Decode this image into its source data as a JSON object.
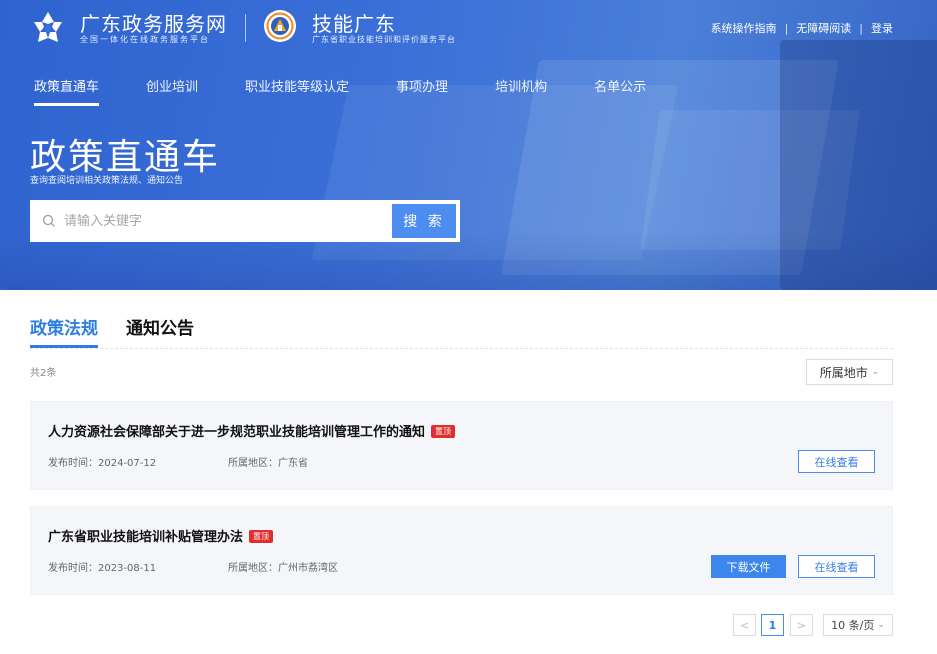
{
  "header": {
    "brand_primary": {
      "title": "广东政务服务网",
      "subtitle": "全国一体化在线政务服务平台"
    },
    "brand_secondary": {
      "title": "技能广东",
      "subtitle": "广东省职业技能培训和评价服务平台"
    },
    "top_links": {
      "guide": "系统操作指南",
      "accessible": "无障碍阅读",
      "login": "登录",
      "separator": "|"
    },
    "nav": [
      {
        "label": "政策直通车",
        "active": true
      },
      {
        "label": "创业培训",
        "active": false
      },
      {
        "label": "职业技能等级认定",
        "active": false
      },
      {
        "label": "事项办理",
        "active": false
      },
      {
        "label": "培训机构",
        "active": false
      },
      {
        "label": "名单公示",
        "active": false
      }
    ]
  },
  "hero": {
    "title": "政策直通车",
    "subtitle": "查询查阅培训相关政策法规、通知公告",
    "search": {
      "placeholder": "请输入关键字",
      "button_label": "搜 索"
    }
  },
  "content": {
    "tabs": [
      {
        "label": "政策法规",
        "active": true
      },
      {
        "label": "通知公告",
        "active": false
      }
    ],
    "count_text": "共2条",
    "city_filter": {
      "label": "所属地市",
      "chevron": "⌄"
    },
    "items": [
      {
        "title": "人力资源社会保障部关于进一步规范职业技能培训管理工作的通知",
        "badge": "置顶",
        "date_label": "发布时间：2024-07-12",
        "region_label": "所属地区：广东省",
        "view_button": "在线查看"
      },
      {
        "title": "广东省职业技能培训补贴管理办法",
        "badge": "置顶",
        "date_label": "发布时间：2023-08-11",
        "region_label": "所属地区：广州市荔湾区",
        "download_button": "下载文件",
        "view_button": "在线查看"
      }
    ],
    "pagination": {
      "prev": "<",
      "current": "1",
      "next": ">",
      "page_size": "10 条/页",
      "page_size_chevron": "⌄"
    }
  },
  "colors": {
    "accent": "#2e7de1",
    "button_blue": "#3c86ee",
    "badge_red": "#e02d2d",
    "hero_blue": "#3a6fd8",
    "card_bg": "#f4f6fa"
  },
  "icons": {
    "brand_primary": "gov-service-logo-icon",
    "brand_secondary": "skills-emblem-icon",
    "search": "search-icon"
  }
}
